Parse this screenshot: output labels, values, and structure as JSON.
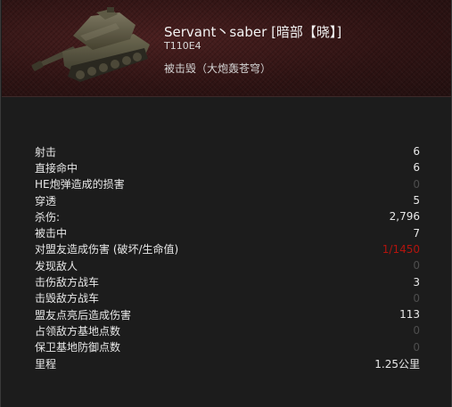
{
  "header": {
    "player_name": "Servant丶saber [暗部【晓】]",
    "tank_name": "T110E4",
    "status": "被击毁（大炮轰苍穹）"
  },
  "colors": {
    "header_bg": "#2f1414",
    "panel_bg": "#1c1c1c",
    "text": "#e8e8e8",
    "zero_value": "#4d4d4d",
    "alert_value": "#b3140e"
  },
  "stats": [
    {
      "label": "射击",
      "value": "6",
      "style": "normal"
    },
    {
      "label": "直接命中",
      "value": "6",
      "style": "normal"
    },
    {
      "label": "HE炮弹造成的损害",
      "value": "0",
      "style": "zero"
    },
    {
      "label": "穿透",
      "value": "5",
      "style": "normal"
    },
    {
      "label": "杀伤:",
      "value": "2,796",
      "style": "normal"
    },
    {
      "label": "被击中",
      "value": "7",
      "style": "normal"
    },
    {
      "label": "对盟友造成伤害 (破坏/生命值)",
      "value": "1/1450",
      "style": "red"
    },
    {
      "label": "发现敌人",
      "value": "0",
      "style": "zero"
    },
    {
      "label": "击伤敌方战车",
      "value": "3",
      "style": "normal"
    },
    {
      "label": "击毁敌方战车",
      "value": "0",
      "style": "zero"
    },
    {
      "label": "盟友点亮后造成伤害",
      "value": "113",
      "style": "normal"
    },
    {
      "label": "占领敌方基地点数",
      "value": "0",
      "style": "zero"
    },
    {
      "label": "保卫基地防御点数",
      "value": "0",
      "style": "zero"
    },
    {
      "label": "里程",
      "value": "1.25公里",
      "style": "normal"
    }
  ]
}
